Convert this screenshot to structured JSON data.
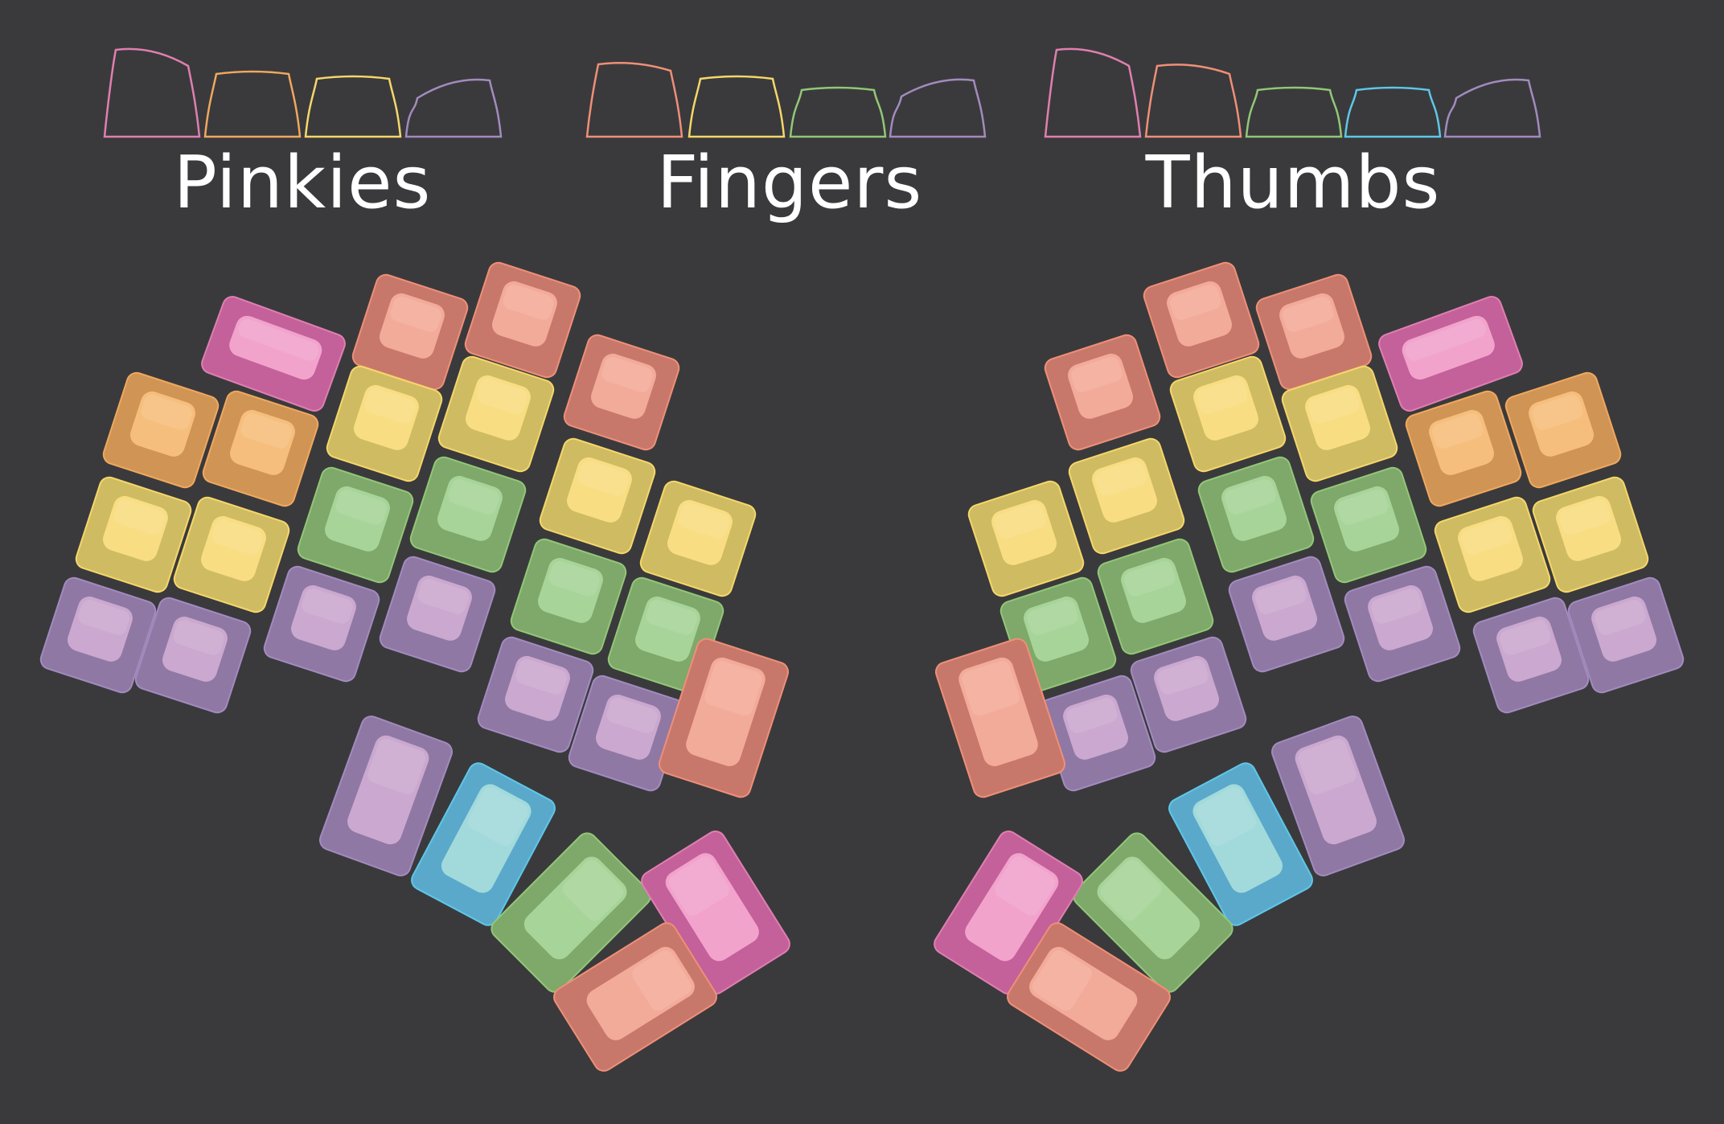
{
  "legend": {
    "pinkies": {
      "title": "Pinkies",
      "profiles": [
        {
          "row": "R1",
          "color": "pink"
        },
        {
          "row": "R2",
          "color": "orange"
        },
        {
          "row": "R3",
          "color": "yellow"
        },
        {
          "row": "R4",
          "color": "purple"
        }
      ]
    },
    "fingers": {
      "title": "Fingers",
      "profiles": [
        {
          "row": "R1",
          "color": "salmon"
        },
        {
          "row": "R2",
          "color": "yellow"
        },
        {
          "row": "R3",
          "color": "green"
        },
        {
          "row": "R4",
          "color": "purple"
        }
      ]
    },
    "thumbs": {
      "title": "Thumbs",
      "profiles": [
        {
          "row": "R1",
          "color": "pink"
        },
        {
          "row": "R2",
          "color": "salmon"
        },
        {
          "row": "R3",
          "color": "green"
        },
        {
          "row": "R4",
          "color": "blue"
        },
        {
          "row": "R5",
          "color": "purple"
        }
      ]
    }
  },
  "palette": {
    "background": "#3a3a3c",
    "pink": {
      "outline": "#e07fb0",
      "top": "#f2a5ce",
      "side": "#c4609a"
    },
    "orange": {
      "outline": "#f0a85e",
      "top": "#f8c07e",
      "side": "#d09455"
    },
    "yellow": {
      "outline": "#f5d76a",
      "top": "#fade84",
      "side": "#cfbb62"
    },
    "purple": {
      "outline": "#a28bbe",
      "top": "#cdaad0",
      "side": "#8f78a4"
    },
    "salmon": {
      "outline": "#ef8f78",
      "top": "#f5ad9b",
      "side": "#c8786a"
    },
    "green": {
      "outline": "#92c777",
      "top": "#a9d59a",
      "side": "#7fa86b"
    },
    "blue": {
      "outline": "#5ec7e8",
      "top": "#a5dcdc",
      "side": "#5aa9cb"
    }
  },
  "keyboard": {
    "left_half": [
      {
        "group": "pinky",
        "color": "pink"
      },
      {
        "group": "pinky",
        "color": "orange"
      },
      {
        "group": "pinky",
        "color": "orange"
      },
      {
        "group": "pinky",
        "color": "yellow"
      },
      {
        "group": "pinky",
        "color": "yellow"
      },
      {
        "group": "pinky",
        "color": "purple"
      },
      {
        "group": "pinky",
        "color": "purple"
      },
      {
        "group": "finger",
        "color": "salmon"
      },
      {
        "group": "finger",
        "color": "salmon"
      },
      {
        "group": "finger",
        "color": "salmon"
      },
      {
        "group": "finger",
        "color": "yellow"
      },
      {
        "group": "finger",
        "color": "yellow"
      },
      {
        "group": "finger",
        "color": "yellow"
      },
      {
        "group": "finger",
        "color": "yellow"
      },
      {
        "group": "finger",
        "color": "green"
      },
      {
        "group": "finger",
        "color": "green"
      },
      {
        "group": "finger",
        "color": "green"
      },
      {
        "group": "finger",
        "color": "green"
      },
      {
        "group": "finger",
        "color": "purple"
      },
      {
        "group": "finger",
        "color": "purple"
      },
      {
        "group": "finger",
        "color": "purple"
      },
      {
        "group": "finger",
        "color": "purple"
      },
      {
        "group": "finger",
        "color": "salmon"
      },
      {
        "group": "thumb",
        "color": "purple"
      },
      {
        "group": "thumb",
        "color": "blue"
      },
      {
        "group": "thumb",
        "color": "green"
      },
      {
        "group": "thumb",
        "color": "pink"
      },
      {
        "group": "thumb",
        "color": "salmon"
      }
    ],
    "right_half": "mirror of left_half"
  }
}
